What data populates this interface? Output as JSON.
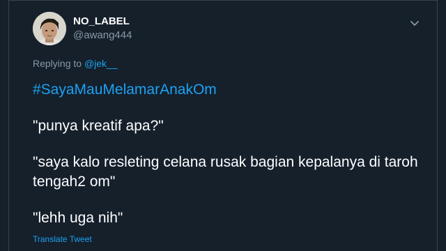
{
  "tweet": {
    "author": {
      "display_name": "NO_LABEL",
      "handle": "@awang444"
    },
    "reply": {
      "prefix": "Replying to ",
      "mention": "@jek__"
    },
    "hashtag": "#SayaMauMelamarAnakOm",
    "paragraphs": [
      "\"punya kreatif apa?\"",
      "\"saya kalo resleting celana rusak bagian kepalanya di taroh tengah2 om\"",
      "\"lehh uga nih\""
    ],
    "translate_label": "Translate Tweet"
  },
  "colors": {
    "background": "#15202b",
    "accent": "#1da1f2",
    "secondary_text": "#8899a6",
    "border": "#38444d"
  },
  "icons": {
    "more": "chevron-down-icon"
  }
}
